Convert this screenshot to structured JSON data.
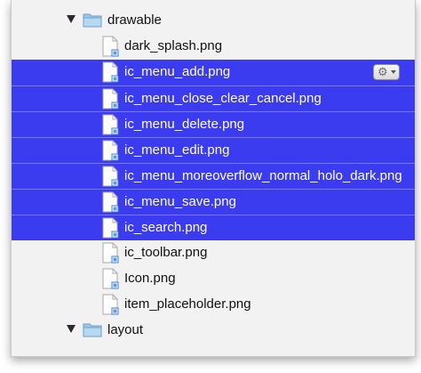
{
  "tree": {
    "folders": [
      {
        "name": "drawable",
        "expanded": true
      },
      {
        "name": "layout",
        "expanded": true
      }
    ],
    "files": [
      {
        "name": "dark_splash.png",
        "selected": false
      },
      {
        "name": "ic_menu_add.png",
        "selected": true
      },
      {
        "name": "ic_menu_close_clear_cancel.png",
        "selected": true
      },
      {
        "name": "ic_menu_delete.png",
        "selected": true
      },
      {
        "name": "ic_menu_edit.png",
        "selected": true
      },
      {
        "name": "ic_menu_moreoverflow_normal_holo_dark.png",
        "selected": true
      },
      {
        "name": "ic_menu_save.png",
        "selected": true
      },
      {
        "name": "ic_search.png",
        "selected": true
      },
      {
        "name": "ic_toolbar.png",
        "selected": false
      },
      {
        "name": "Icon.png",
        "selected": false
      },
      {
        "name": "item_placeholder.png",
        "selected": false
      }
    ],
    "action_button": {
      "icon": "gear-icon",
      "has_dropdown": true
    }
  },
  "colors": {
    "selection": "#3b3bf0",
    "selection_text": "#ffffff",
    "folder": "#9cc7ea",
    "background": "#f2f2f2"
  }
}
